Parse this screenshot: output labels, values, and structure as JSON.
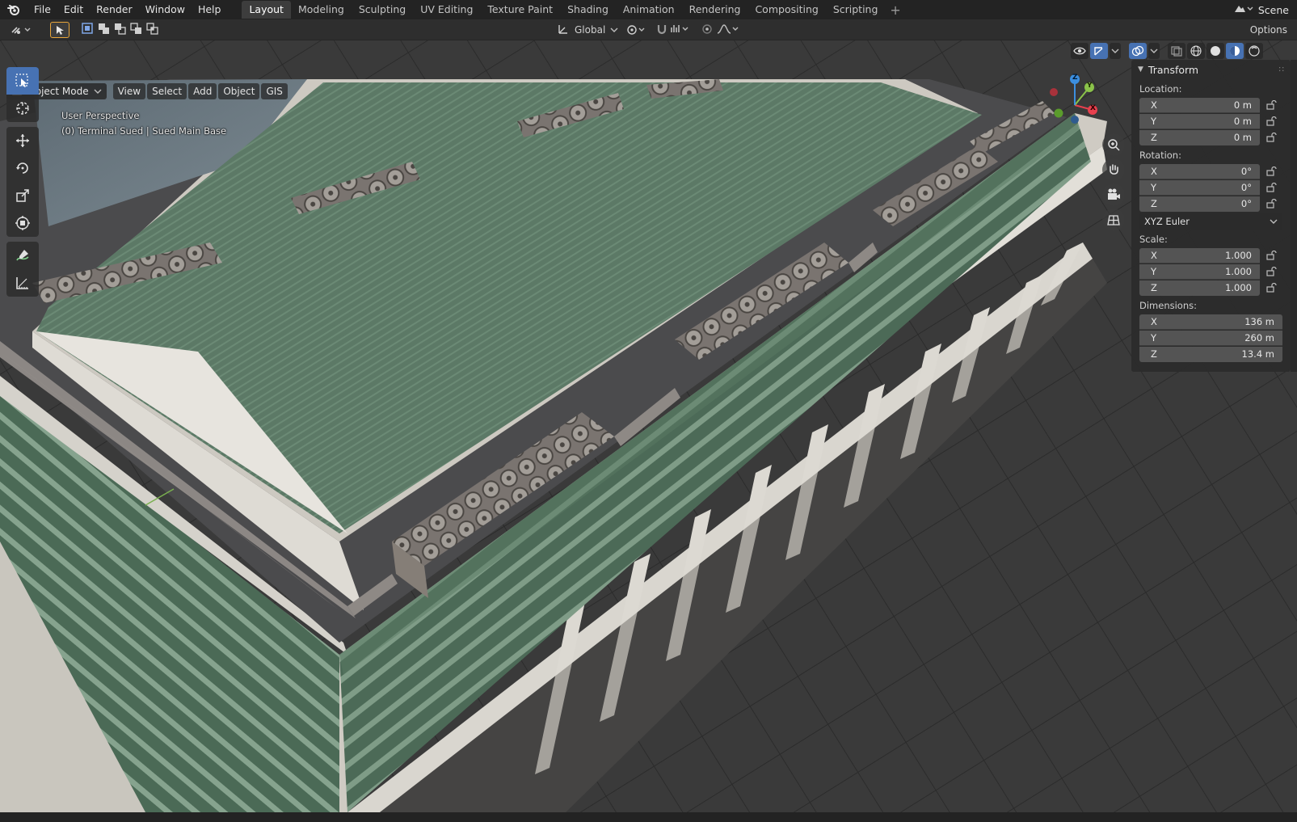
{
  "menu": {
    "file": "File",
    "edit": "Edit",
    "render": "Render",
    "window": "Window",
    "help": "Help"
  },
  "workspaces": [
    {
      "label": "Layout",
      "active": true
    },
    {
      "label": "Modeling",
      "active": false
    },
    {
      "label": "Sculpting",
      "active": false
    },
    {
      "label": "UV Editing",
      "active": false
    },
    {
      "label": "Texture Paint",
      "active": false
    },
    {
      "label": "Shading",
      "active": false
    },
    {
      "label": "Animation",
      "active": false
    },
    {
      "label": "Rendering",
      "active": false
    },
    {
      "label": "Compositing",
      "active": false
    },
    {
      "label": "Scripting",
      "active": false
    }
  ],
  "scene": {
    "label": "Scene"
  },
  "header": {
    "orientation": "Global",
    "options": "Options"
  },
  "viewport": {
    "mode": "Object Mode",
    "menus": [
      "View",
      "Select",
      "Add",
      "Object",
      "GIS"
    ],
    "perspective": "User Perspective",
    "object_info": "(0) Terminal Sued | Sued Main Base"
  },
  "icons": {
    "tools": [
      "select-box-icon",
      "cursor-icon",
      "move-icon",
      "rotate-icon",
      "scale-icon",
      "transform-icon",
      "annotate-icon",
      "measure-icon"
    ],
    "nav": [
      "zoom-icon",
      "pan-hand-icon",
      "camera-icon",
      "grid-perspective-icon"
    ]
  },
  "gizmo": {
    "x": "X",
    "y": "Y",
    "z": "Z"
  },
  "transform": {
    "title": "Transform",
    "location_label": "Location:",
    "location": [
      {
        "axis": "X",
        "value": "0 m"
      },
      {
        "axis": "Y",
        "value": "0 m"
      },
      {
        "axis": "Z",
        "value": "0 m"
      }
    ],
    "rotation_label": "Rotation:",
    "rotation": [
      {
        "axis": "X",
        "value": "0°"
      },
      {
        "axis": "Y",
        "value": "0°"
      },
      {
        "axis": "Z",
        "value": "0°"
      }
    ],
    "rotation_mode": "XYZ Euler",
    "scale_label": "Scale:",
    "scale": [
      {
        "axis": "X",
        "value": "1.000"
      },
      {
        "axis": "Y",
        "value": "1.000"
      },
      {
        "axis": "Z",
        "value": "1.000"
      }
    ],
    "dimensions_label": "Dimensions:",
    "dimensions": [
      {
        "axis": "X",
        "value": "136 m"
      },
      {
        "axis": "Y",
        "value": "260 m"
      },
      {
        "axis": "Z",
        "value": "13.4 m"
      }
    ]
  },
  "colors": {
    "accent": "#4772b3",
    "axis_x": "#e8404e",
    "axis_y": "#8bc34a",
    "axis_z": "#3c8fe0",
    "roof_green": "#5d7a66"
  }
}
